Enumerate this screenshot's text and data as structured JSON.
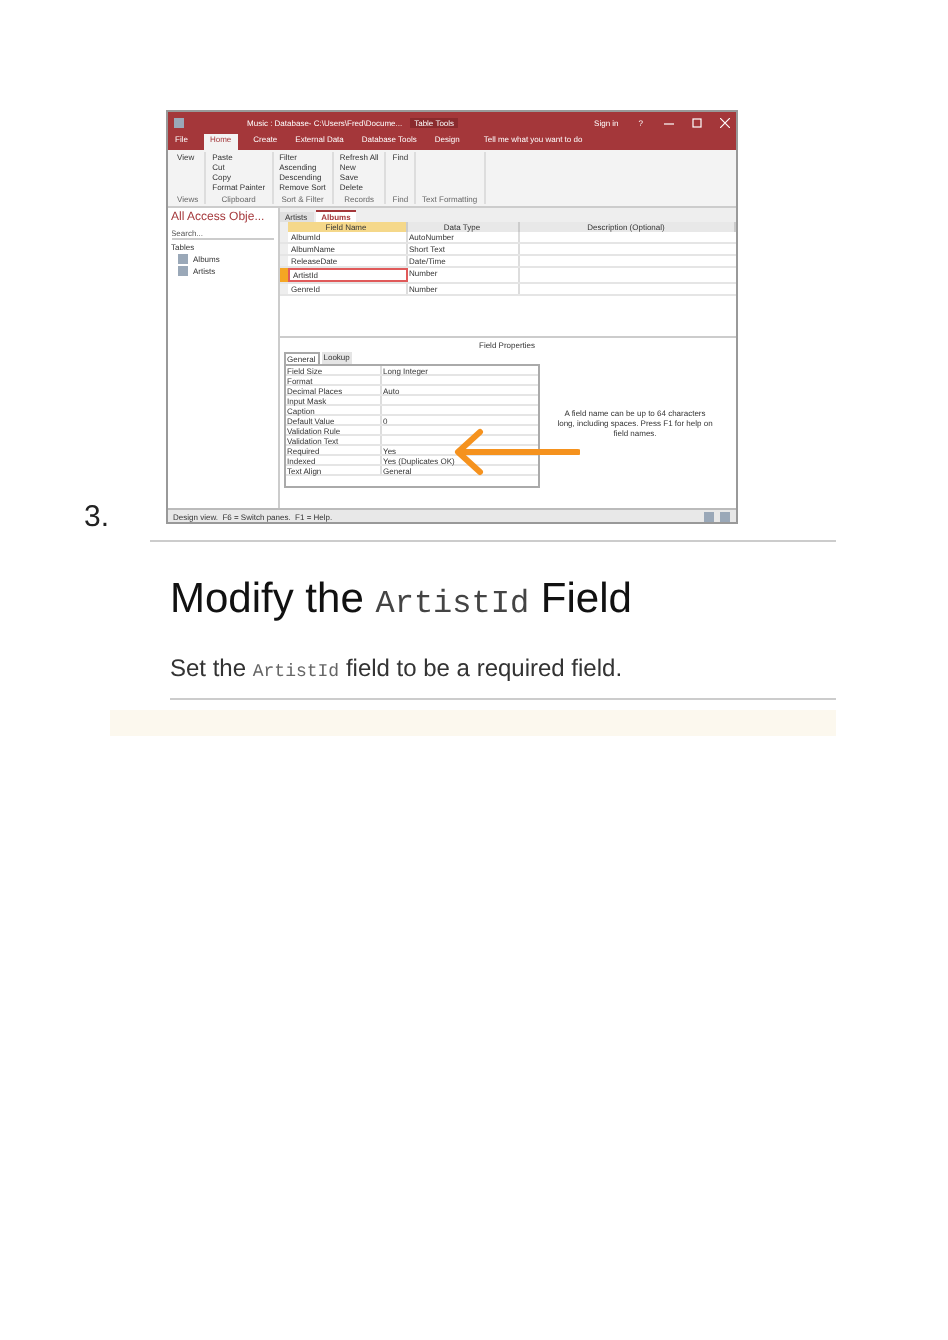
{
  "list_number": "3.",
  "access_window": {
    "title": "Music : Database- C:\\Users\\Fred\\Docume...",
    "context_title": "Table Tools",
    "sign_in": "Sign in",
    "help": "?",
    "tabs": [
      {
        "label": "File",
        "selected": false
      },
      {
        "label": "Home",
        "selected": true
      },
      {
        "label": "Create",
        "selected": false
      },
      {
        "label": "External Data",
        "selected": false
      },
      {
        "label": "Database Tools",
        "selected": false
      },
      {
        "label": "Design",
        "selected": false
      }
    ],
    "tell_me": "Tell me what you want to do",
    "ribbon_groups": [
      {
        "label": "Views",
        "commands": [
          "View"
        ]
      },
      {
        "label": "Clipboard",
        "commands": [
          "Paste",
          "Cut",
          "Copy",
          "Format Painter"
        ]
      },
      {
        "label": "Sort & Filter",
        "commands": [
          "Filter",
          "Ascending",
          "Descending",
          "Remove Sort"
        ]
      },
      {
        "label": "Records",
        "commands": [
          "Refresh All",
          "New",
          "Save",
          "Delete"
        ]
      },
      {
        "label": "Find",
        "commands": [
          "Find"
        ]
      },
      {
        "label": "Text Formatting"
      }
    ],
    "nav_pane": {
      "title": "All Access Obje...",
      "search": {
        "placeholder": "Search..."
      },
      "section": "Tables",
      "items": [
        "Albums",
        "Artists"
      ]
    },
    "doc_tabs": [
      {
        "label": "Artists",
        "selected": false
      },
      {
        "label": "Albums",
        "selected": true
      }
    ],
    "grid": {
      "columns": [
        "Field Name",
        "Data Type",
        "Description (Optional)"
      ],
      "rows": [
        {
          "field_name": "AlbumId",
          "data_type": "AutoNumber",
          "selected": false
        },
        {
          "field_name": "AlbumName",
          "data_type": "Short Text",
          "selected": false
        },
        {
          "field_name": "ReleaseDate",
          "data_type": "Date/Time",
          "selected": false
        },
        {
          "field_name": "ArtistId",
          "data_type": "Number",
          "selected": true
        },
        {
          "field_name": "GenreId",
          "data_type": "Number",
          "selected": false
        }
      ]
    },
    "field_properties": {
      "title": "Field Properties",
      "tabs": [
        {
          "label": "General",
          "selected": true
        },
        {
          "label": "Lookup",
          "selected": false
        }
      ],
      "rows": [
        {
          "name": "Field Size",
          "value": "Long Integer"
        },
        {
          "name": "Format"
        },
        {
          "name": "Decimal Places",
          "value": "Auto"
        },
        {
          "name": "Input Mask"
        },
        {
          "name": "Caption"
        },
        {
          "name": "Default Value",
          "value": "0"
        },
        {
          "name": "Validation Rule"
        },
        {
          "name": "Validation Text"
        },
        {
          "name": "Required",
          "value": "Yes"
        },
        {
          "name": "Indexed",
          "value": "Yes (Duplicates OK)"
        },
        {
          "name": "Text Align",
          "value": "General"
        }
      ],
      "help": "A field name can be up to 64 characters long, including spaces. Press F1 for help on field names."
    },
    "status_bar": "Design view.  F6 = Switch panes.  F1 = Help."
  },
  "heading": {
    "before": "Modify the",
    "code": "ArtistId",
    "after": "Field"
  },
  "instruction": {
    "before": "Set the",
    "code": "ArtistId",
    "after": "field to be a required field."
  }
}
